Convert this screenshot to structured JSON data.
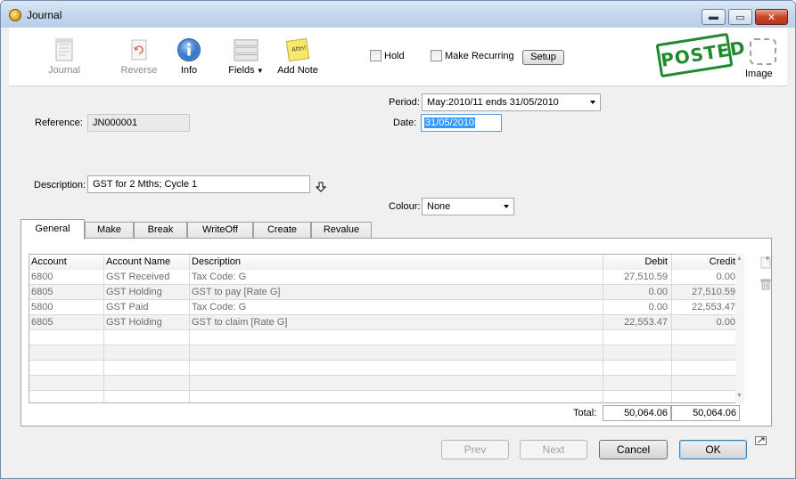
{
  "window": {
    "title": "Journal",
    "min_glyph": "▬",
    "max_glyph": "▭",
    "close_glyph": "✕"
  },
  "toolbar": {
    "journal": "Journal",
    "reverse": "Reverse",
    "info": "Info",
    "fields": "Fields",
    "add_note": "Add Note",
    "note_text": "Attn!",
    "hold": "Hold",
    "make_recurring": "Make Recurring",
    "setup": "Setup",
    "status_stamp": "POSTED",
    "image": "Image"
  },
  "form": {
    "reference_label": "Reference:",
    "reference_value": "JN000001",
    "period_label": "Period:",
    "period_value": "May:2010/11 ends 31/05/2010",
    "date_label": "Date:",
    "date_value": "31/05/2010",
    "description_label": "Description:",
    "description_value": "GST for 2 Mths; Cycle 1",
    "colour_label": "Colour:",
    "colour_value": "None"
  },
  "tabs": [
    "General",
    "Make",
    "Break",
    "WriteOff",
    "Create",
    "Revalue"
  ],
  "table": {
    "columns": [
      "Account",
      "Account Name",
      "Description",
      "Debit",
      "Credit"
    ],
    "rows": [
      [
        "6800",
        "GST Received",
        "Tax Code: G",
        "27,510.59",
        "0.00"
      ],
      [
        "6805",
        "GST Holding",
        "GST to pay [Rate G]",
        "0.00",
        "27,510.59"
      ],
      [
        "5800",
        "GST Paid",
        "Tax Code: G",
        "0.00",
        "22,553.47"
      ],
      [
        "6805",
        "GST Holding",
        "GST to claim [Rate G]",
        "22,553.47",
        "0.00"
      ]
    ],
    "total_label": "Total:",
    "total_debit": "50,064.06",
    "total_credit": "50,064.06"
  },
  "buttons": {
    "prev": "Prev",
    "next": "Next",
    "cancel": "Cancel",
    "ok": "OK"
  }
}
